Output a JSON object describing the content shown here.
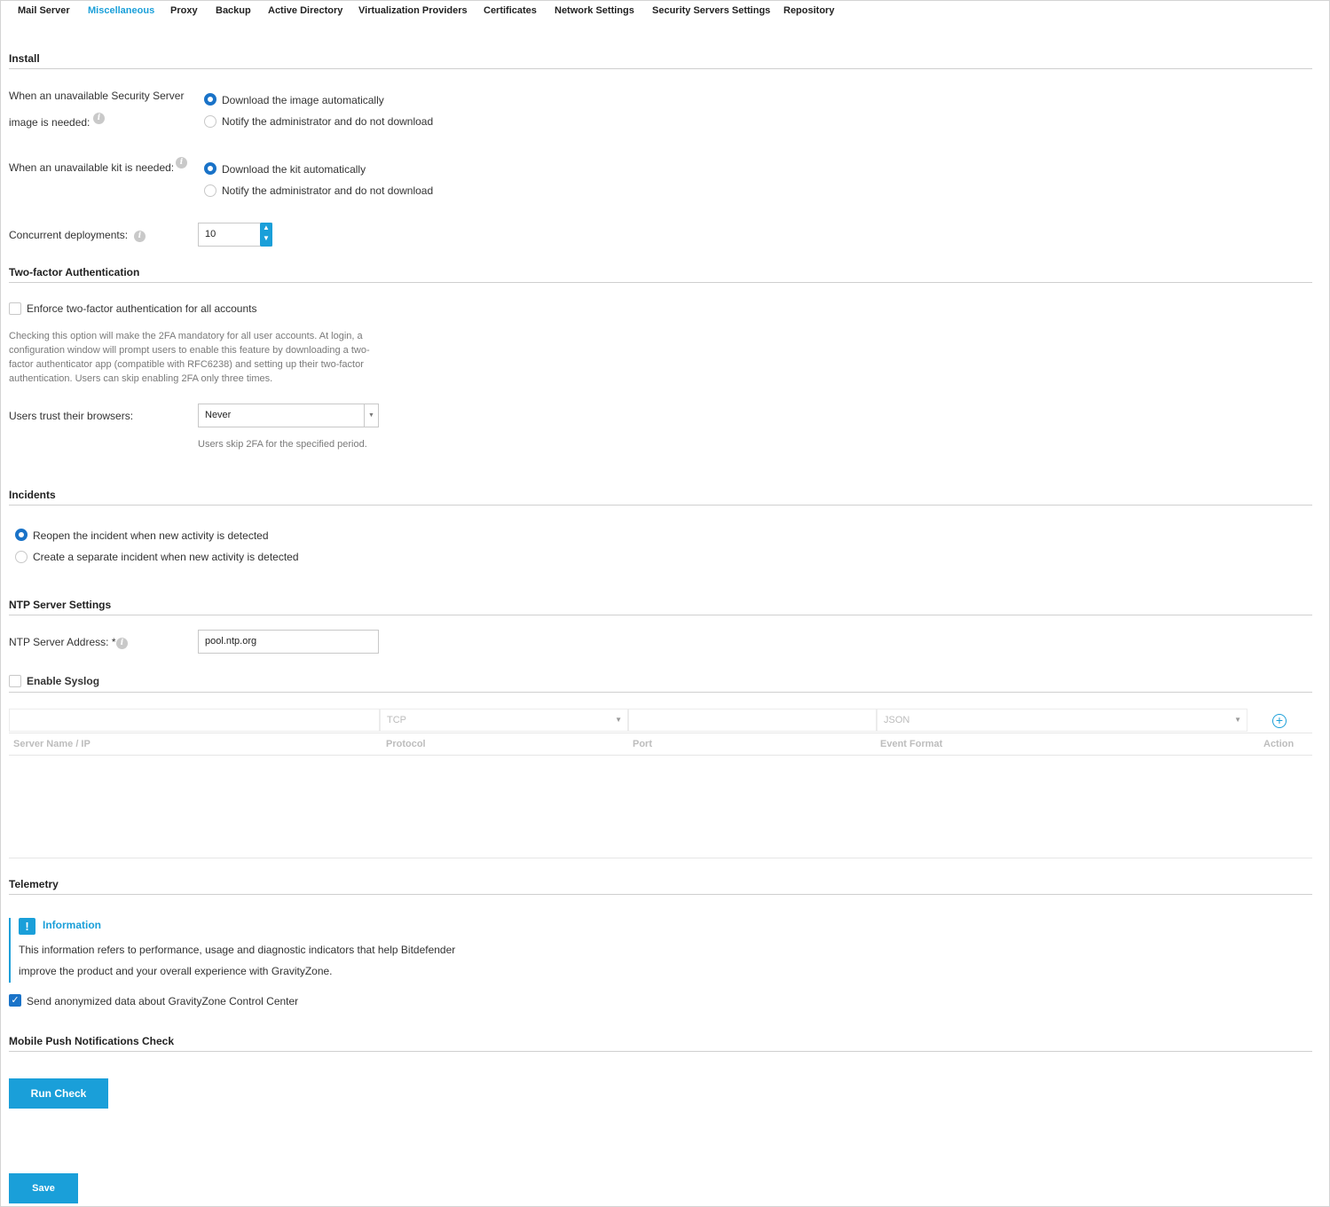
{
  "tabs": [
    {
      "label": "Mail Server",
      "active": false
    },
    {
      "label": "Miscellaneous",
      "active": true
    },
    {
      "label": "Proxy",
      "active": false
    },
    {
      "label": "Backup",
      "active": false
    },
    {
      "label": "Active Directory",
      "active": false
    },
    {
      "label": "Virtualization Providers",
      "active": false
    },
    {
      "label": "Certificates",
      "active": false
    },
    {
      "label": "Network Settings",
      "active": false
    },
    {
      "label": "Security Servers Settings",
      "active": false
    },
    {
      "label": "Repository",
      "active": false
    }
  ],
  "install": {
    "title": "Install",
    "image_label_line1": "When an unavailable Security Server",
    "image_label_line2": "image is needed:",
    "image_opt1": "Download the image automatically",
    "image_opt2": "Notify the administrator and do not download",
    "kit_label": "When an unavailable kit is needed:",
    "kit_opt1": "Download the kit automatically",
    "kit_opt2": "Notify the administrator and do not download",
    "concurrent_label": "Concurrent deployments:",
    "concurrent_value": "10"
  },
  "twofa": {
    "title": "Two-factor Authentication",
    "enforce_label": "Enforce two-factor authentication for all accounts",
    "help_lines": [
      "Checking this option will make the 2FA mandatory for all user accounts. At login, a",
      "configuration window will prompt users to enable this feature by downloading a two-",
      "factor authenticator app (compatible with RFC6238) and setting up their two-factor",
      "authentication. Users can skip enabling 2FA only three times."
    ],
    "trust_label": "Users trust their browsers:",
    "trust_value": "Never",
    "trust_help": "Users skip 2FA for the specified period."
  },
  "incidents": {
    "title": "Incidents",
    "opt1": "Reopen the incident when new activity is detected",
    "opt2": "Create a separate incident when new activity is detected"
  },
  "ntp": {
    "title": "NTP Server Settings",
    "address_label": "NTP Server Address: *",
    "address_value": "pool.ntp.org"
  },
  "syslog": {
    "title": "Enable Syslog",
    "protocol_filter": "TCP",
    "format_filter": "JSON",
    "columns": [
      "Server Name / IP",
      "Protocol",
      "Port",
      "Event Format",
      "Action"
    ]
  },
  "telemetry": {
    "title": "Telemetry",
    "info_title": "Information",
    "info_line1": "This information refers to performance, usage and diagnostic indicators that help Bitdefender",
    "info_line2": "improve the product and your overall experience with GravityZone.",
    "send_label": "Send anonymized data about GravityZone Control Center"
  },
  "mobile": {
    "title": "Mobile Push Notifications Check",
    "run_check": "Run Check"
  },
  "save_label": "Save",
  "colors": {
    "accent": "#1a9fd9",
    "radio": "#1a73c8"
  }
}
